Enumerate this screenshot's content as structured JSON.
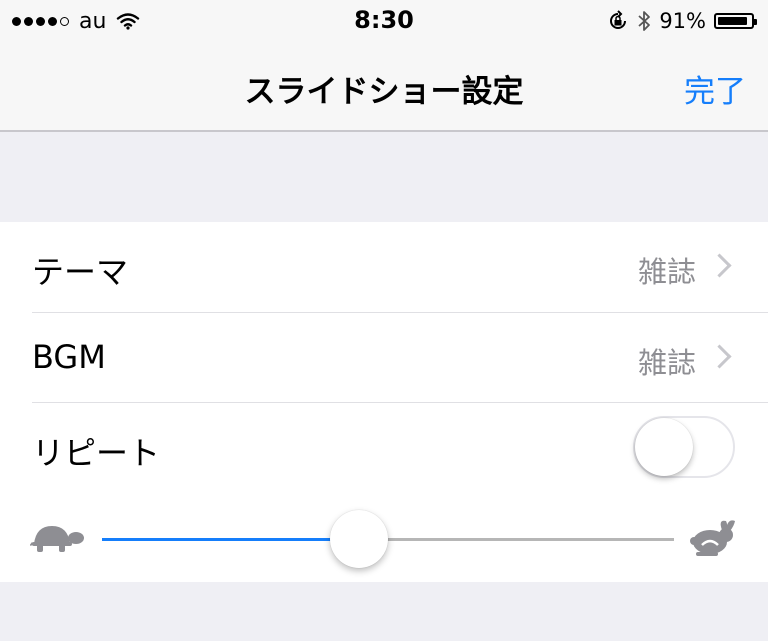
{
  "status_bar": {
    "carrier": "au",
    "time": "8:30",
    "battery_text": "91%",
    "battery_level": 0.91
  },
  "nav": {
    "title": "スライドショー設定",
    "done_label": "完了",
    "accent_color": "#157efb"
  },
  "settings": {
    "theme": {
      "label": "テーマ",
      "value": "雑誌"
    },
    "bgm": {
      "label": "BGM",
      "value": "雑誌"
    },
    "repeat": {
      "label": "リピート",
      "on": false
    }
  },
  "speed_slider": {
    "value": 0.45,
    "min_icon": "turtle-icon",
    "max_icon": "rabbit-icon"
  }
}
